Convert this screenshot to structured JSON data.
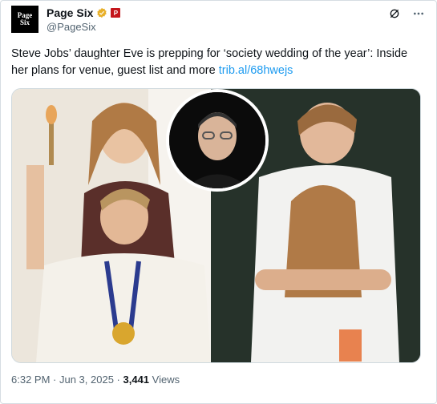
{
  "account": {
    "avatar_line1": "Page",
    "avatar_line2": "Six",
    "display_name": "Page Six",
    "handle": "@PageSix",
    "affiliate_badge": "P"
  },
  "tweet": {
    "text": "Steve Jobs’ daughter Eve is prepping for ‘society wedding of the year’: Inside her plans for venue, guest list and more ",
    "link": "trib.al/68hwejs"
  },
  "meta": {
    "time": "6:32 PM",
    "separator1": " · ",
    "date": "Jun 3, 2025",
    "separator2": " · ",
    "views_count": "3,441",
    "views_label": " Views"
  },
  "icons": {
    "verified": "verified-gold-icon",
    "grok": "grok-icon",
    "more": "more-icon"
  },
  "colors": {
    "link": "#1d9bf0",
    "verified_gold": "#e8b02a",
    "affiliate_red": "#c4161c"
  }
}
